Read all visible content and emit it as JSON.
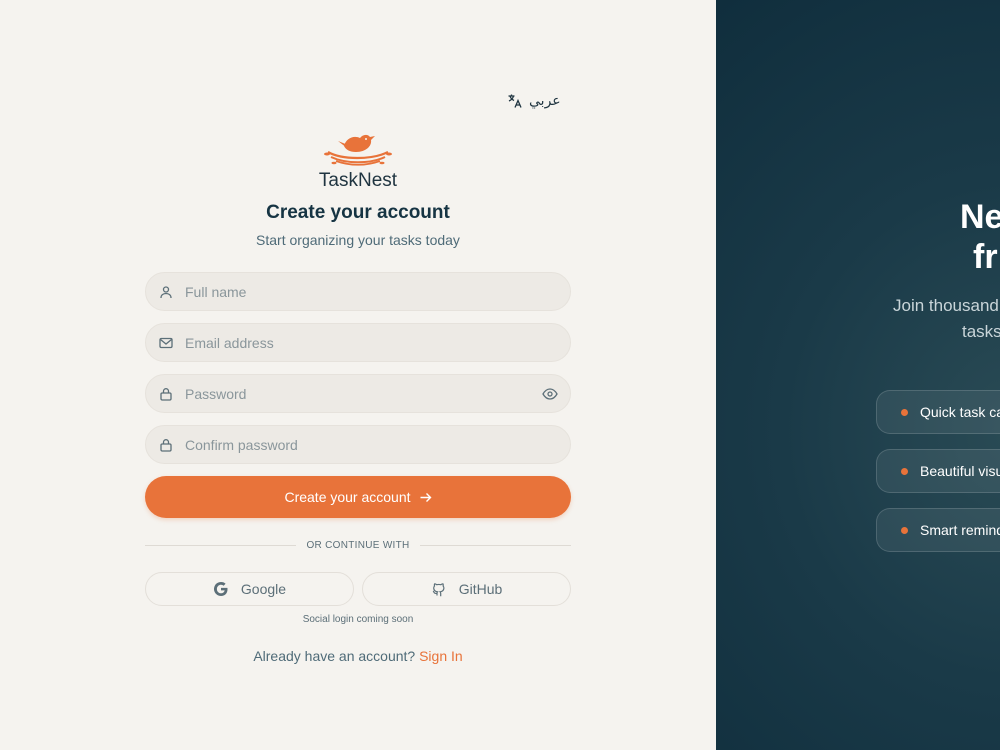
{
  "language_toggle": {
    "label": "عربي",
    "icon": "translate-icon"
  },
  "brand": {
    "name": "TaskNest",
    "logo": "bird-nest-logo",
    "accent": "#e8733a"
  },
  "heading": {
    "title": "Create your account",
    "subtitle": "Start organizing your tasks today"
  },
  "form": {
    "full_name": {
      "placeholder": "Full name",
      "value": "",
      "icon": "user-icon"
    },
    "email": {
      "placeholder": "Email address",
      "value": "",
      "icon": "mail-icon"
    },
    "password": {
      "placeholder": "Password",
      "value": "",
      "icon": "lock-icon",
      "toggle_icon": "eye-icon"
    },
    "confirm_password": {
      "placeholder": "Confirm password",
      "value": "",
      "icon": "lock-icon"
    },
    "submit_label": "Create your account"
  },
  "divider_text": "OR CONTINUE WITH",
  "social": {
    "google_label": "Google",
    "github_label": "GitHub",
    "note": "Social login coming soon"
  },
  "footer": {
    "prompt": "Already have an account?",
    "link": "Sign In"
  },
  "hero": {
    "line1": "Ne",
    "line2": "fr",
    "desc_line1": "Join thousand",
    "desc_line2": "tasks",
    "features": [
      "Quick task ca",
      "Beautiful visu",
      "Smart remind"
    ],
    "background": "#0f2d3c"
  }
}
